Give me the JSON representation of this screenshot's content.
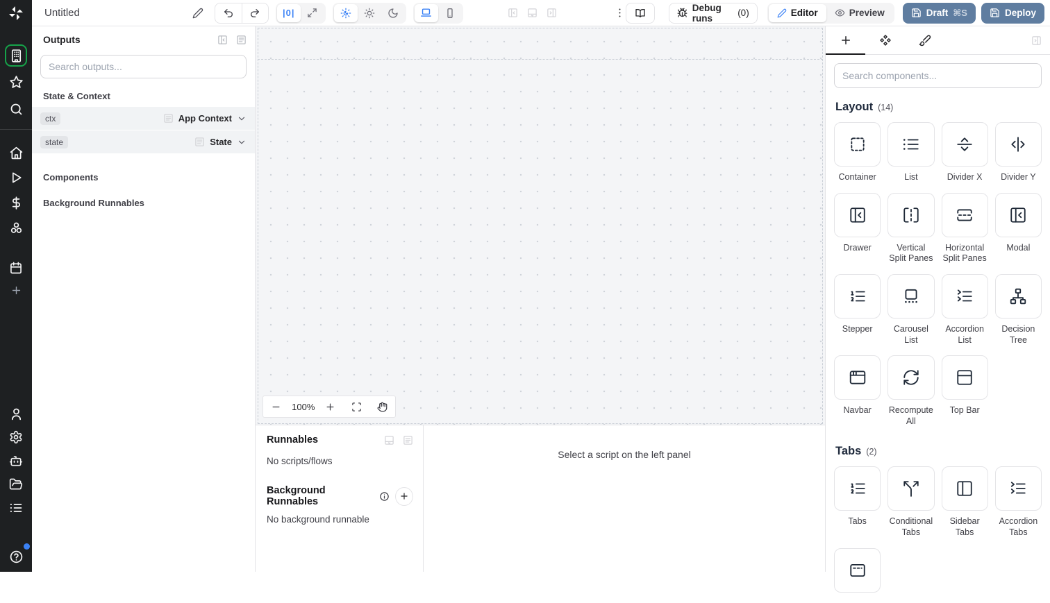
{
  "colors": {
    "accent": "#3b82f6",
    "deploy_button": "#5f7da0",
    "active_green": "#16a34a"
  },
  "topbar": {
    "title": "Untitled",
    "align_glyph": "|0|",
    "debug_runs_label": "Debug runs",
    "debug_runs_count": "(0)",
    "editor_label": "Editor",
    "preview_label": "Preview",
    "draft_label": "Draft",
    "draft_shortcut": "⌘S",
    "deploy_label": "Deploy"
  },
  "outputs_panel": {
    "title": "Outputs",
    "search_placeholder": "Search outputs...",
    "sections": {
      "state_context": "State & Context",
      "components": "Components",
      "background_runnables": "Background Runnables"
    },
    "rows": [
      {
        "badge": "ctx",
        "type": "App Context"
      },
      {
        "badge": "state",
        "type": "State"
      }
    ]
  },
  "canvas": {
    "zoom_level": "100%"
  },
  "runnables_panel": {
    "title": "Runnables",
    "empty_scripts": "No scripts/flows",
    "background_title": "Background Runnables",
    "empty_background": "No background runnable",
    "select_hint": "Select a script on the left panel"
  },
  "components_panel": {
    "search_placeholder": "Search components...",
    "sections": [
      {
        "title": "Layout",
        "count": "(14)",
        "items": [
          {
            "label": "Container"
          },
          {
            "label": "List"
          },
          {
            "label": "Divider X"
          },
          {
            "label": "Divider Y"
          },
          {
            "label": "Drawer"
          },
          {
            "label": "Vertical Split Panes"
          },
          {
            "label": "Horizontal Split Panes"
          },
          {
            "label": "Modal"
          },
          {
            "label": "Stepper"
          },
          {
            "label": "Carousel List"
          },
          {
            "label": "Accordion List"
          },
          {
            "label": "Decision Tree"
          },
          {
            "label": "Navbar"
          },
          {
            "label": "Recompute All"
          },
          {
            "label": "Top Bar"
          }
        ]
      },
      {
        "title": "Tabs",
        "count": "(2)",
        "items": [
          {
            "label": "Tabs"
          },
          {
            "label": "Conditional Tabs"
          },
          {
            "label": "Sidebar Tabs"
          },
          {
            "label": "Accordion Tabs"
          },
          {
            "label": ""
          }
        ]
      }
    ]
  }
}
